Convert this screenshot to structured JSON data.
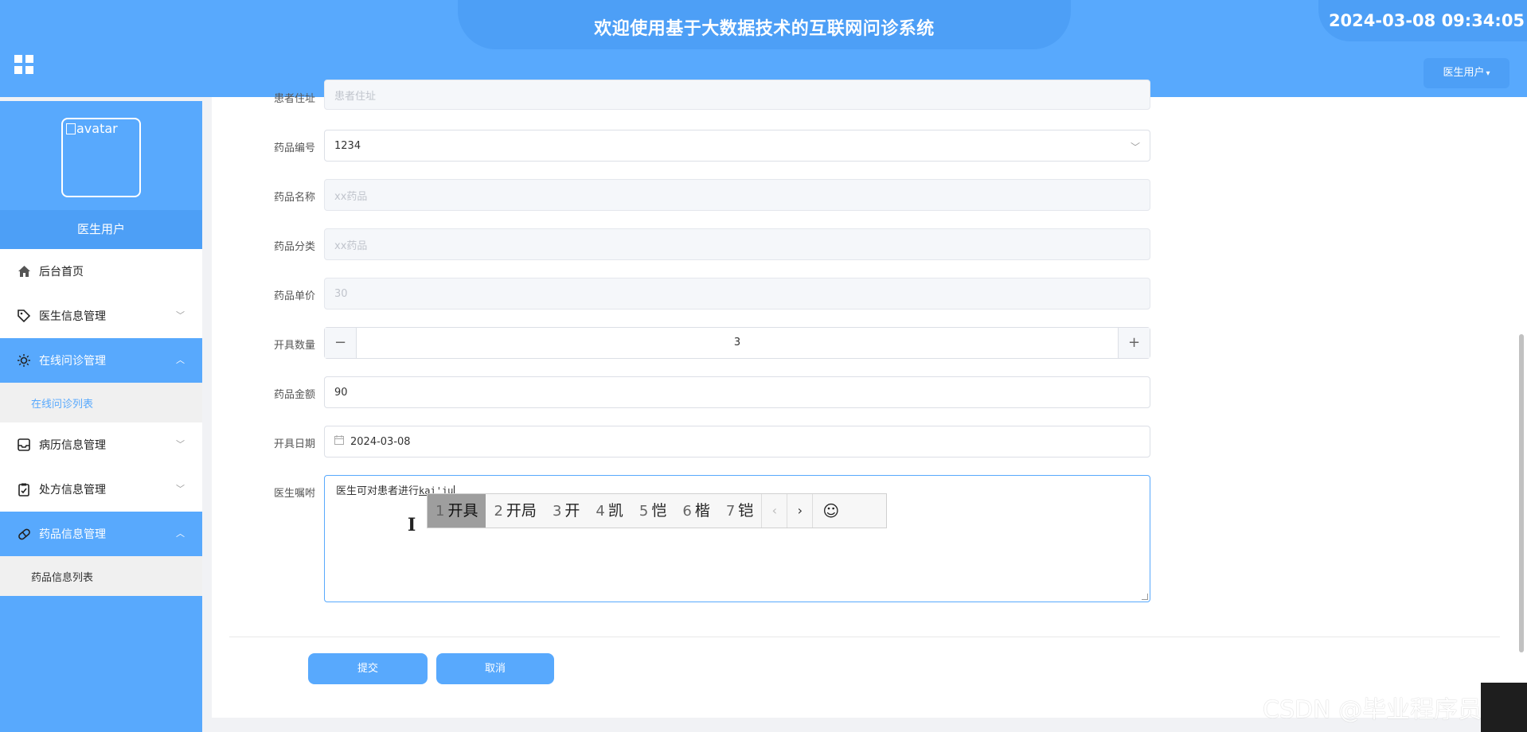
{
  "header": {
    "title": "欢迎使用基于大数据技术的互联网问诊系统",
    "datetime": "2024-03-08 09:34:05",
    "user_menu_label": "医生用户",
    "menu_toggle_icon": "grid-icon"
  },
  "sidebar": {
    "avatar_alt": "avatar",
    "user_name": "医生用户",
    "items": [
      {
        "label": "后台首页",
        "icon": "home-icon",
        "active": false
      },
      {
        "label": "医生信息管理",
        "icon": "tag-icon",
        "active": false
      },
      {
        "label": "在线问诊管理",
        "icon": "sun-icon",
        "active": true,
        "sub": [
          {
            "label": "在线问诊列表"
          }
        ]
      },
      {
        "label": "病历信息管理",
        "icon": "inbox-icon",
        "active": false
      },
      {
        "label": "处方信息管理",
        "icon": "clipboard-icon",
        "active": false
      },
      {
        "label": "药品信息管理",
        "icon": "pill-icon",
        "active": true,
        "sub": [
          {
            "label": "药品信息列表"
          }
        ]
      }
    ]
  },
  "form": {
    "patient_address": {
      "label": "患者住址",
      "placeholder": "患者住址"
    },
    "drug_code": {
      "label": "药品编号",
      "value": "1234"
    },
    "drug_name": {
      "label": "药品名称",
      "value": "xx药品"
    },
    "drug_category": {
      "label": "药品分类",
      "value": "xx药品"
    },
    "unit_price": {
      "label": "药品单价",
      "value": "30"
    },
    "quantity": {
      "label": "开具数量",
      "value": "3",
      "minus": "−",
      "plus": "+"
    },
    "amount": {
      "label": "药品金额",
      "value": "90"
    },
    "issue_date": {
      "label": "开具日期",
      "value": "2024-03-08"
    },
    "advice": {
      "label": "医生嘱咐",
      "text": "医生可对患者进行",
      "composing": "kai'ju"
    },
    "submit_label": "提交",
    "cancel_label": "取消"
  },
  "ime": {
    "candidates": [
      {
        "num": "1",
        "text": "开具"
      },
      {
        "num": "2",
        "text": "开局"
      },
      {
        "num": "3",
        "text": "开"
      },
      {
        "num": "4",
        "text": "凯"
      },
      {
        "num": "5",
        "text": "恺"
      },
      {
        "num": "6",
        "text": "楷"
      },
      {
        "num": "7",
        "text": "铠"
      }
    ],
    "selected_index": 0,
    "prev": "‹",
    "next": "›",
    "emoji": "☺"
  },
  "watermark": "CSDN @毕业程序员"
}
